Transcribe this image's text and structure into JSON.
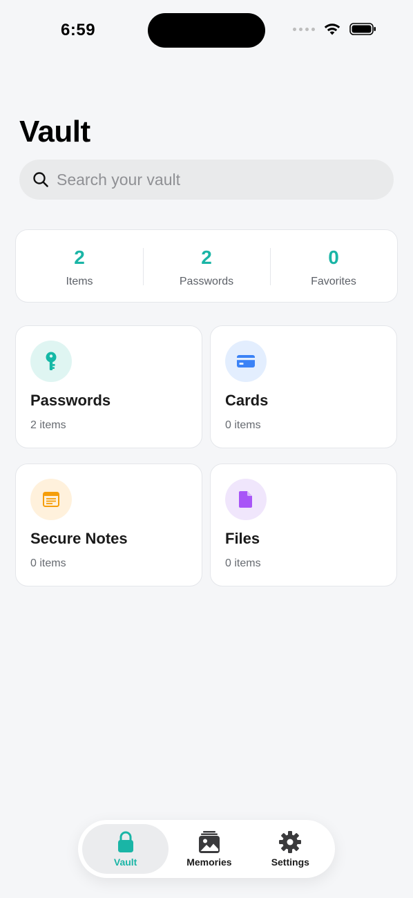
{
  "status_bar": {
    "time": "6:59"
  },
  "page": {
    "title": "Vault"
  },
  "search": {
    "placeholder": "Search your vault"
  },
  "stats": [
    {
      "value": "2",
      "label": "Items"
    },
    {
      "value": "2",
      "label": "Passwords"
    },
    {
      "value": "0",
      "label": "Favorites"
    }
  ],
  "categories": [
    {
      "title": "Passwords",
      "count": "2 items",
      "icon": "key-icon",
      "color": "#14b8a6",
      "bg": "#dff5f2"
    },
    {
      "title": "Cards",
      "count": "0 items",
      "icon": "credit-card-icon",
      "color": "#3b82f6",
      "bg": "#e3eefe"
    },
    {
      "title": "Secure Notes",
      "count": "0 items",
      "icon": "note-icon",
      "color": "#f59e0b",
      "bg": "#fff1dc"
    },
    {
      "title": "Files",
      "count": "0 items",
      "icon": "file-icon",
      "color": "#a855f7",
      "bg": "#f0e6fc"
    }
  ],
  "tab_bar": {
    "tabs": [
      {
        "label": "Vault",
        "icon": "lock-icon",
        "active": true
      },
      {
        "label": "Memories",
        "icon": "photos-icon",
        "active": false
      },
      {
        "label": "Settings",
        "icon": "gear-icon",
        "active": false
      }
    ]
  },
  "colors": {
    "accent": "#1ab5a6"
  }
}
